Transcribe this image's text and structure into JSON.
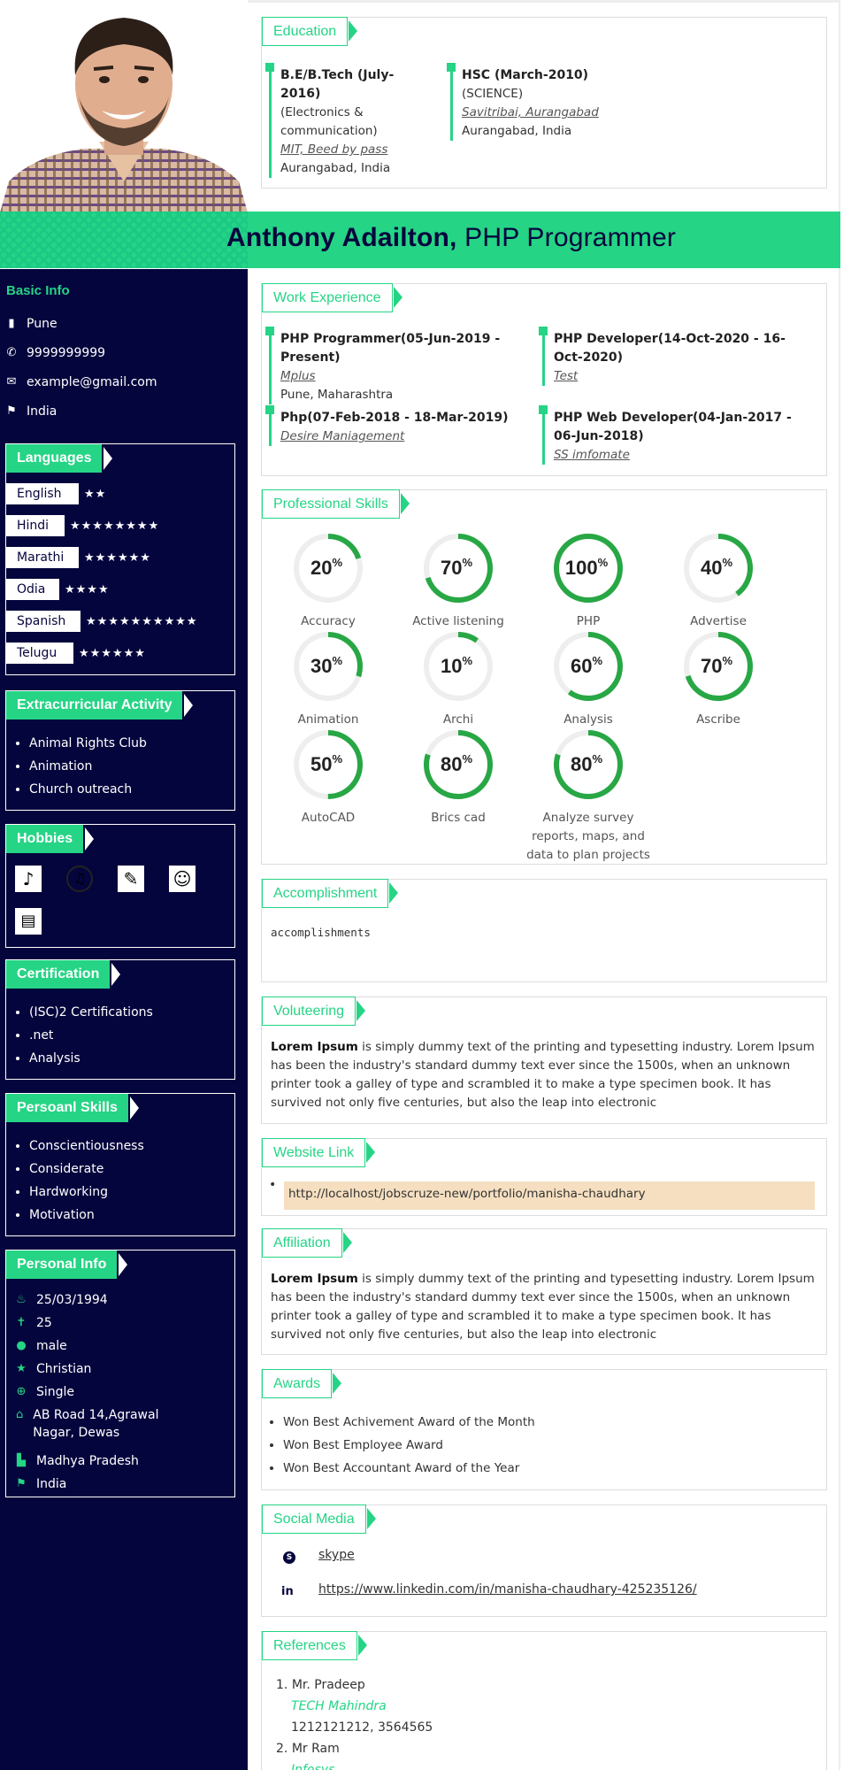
{
  "profile": {
    "first_name": "Anthony Adailton,",
    "role": "PHP Programmer"
  },
  "basic_info": {
    "title": "Basic Info",
    "city": "Pune",
    "phone": "9999999999",
    "email": "example@gmail.com",
    "country": "India"
  },
  "languages": {
    "title": "Languages",
    "items": [
      {
        "name": "English",
        "stars": "★★"
      },
      {
        "name": "Hindi",
        "stars": "★★★★★★★★"
      },
      {
        "name": "Marathi",
        "stars": "★★★★★★"
      },
      {
        "name": "Odia",
        "stars": "★★★★"
      },
      {
        "name": "Spanish",
        "stars": "★★★★★★★★★★"
      },
      {
        "name": "Telugu",
        "stars": "★★★★★★"
      }
    ]
  },
  "extracurricular": {
    "title": "Extracurricular Activity",
    "items": [
      "Animal Rights Club",
      "Animation",
      "Church outreach"
    ]
  },
  "hobbies": {
    "title": "Hobbies",
    "icons": [
      "guitar-icon",
      "music-icon",
      "paint-icon",
      "dance-icon",
      "book-icon"
    ]
  },
  "certification": {
    "title": "Certification",
    "items": [
      "(ISC)2 Certifications",
      ".net",
      "Analysis"
    ]
  },
  "personal_skills": {
    "title": "Persoanl Skills",
    "items": [
      "Conscientiousness",
      "Considerate",
      "Hardworking",
      "Motivation"
    ]
  },
  "personal_info": {
    "title": "Personal Info",
    "dob": "25/03/1994",
    "age": "25",
    "gender": "male",
    "religion": "Christian",
    "status": "Single",
    "address": "AB Road 14,Agrawal Nagar, Dewas",
    "state": "Madhya Pradesh",
    "country": "India"
  },
  "education": {
    "title": "Education",
    "items": [
      {
        "degree": "B.E/B.Tech (July-2016)",
        "field": "(Electronics & communication)",
        "school": "MIT, Beed by pass",
        "place": "Aurangabad, India"
      },
      {
        "degree": "HSC (March-2010)",
        "field": "(SCIENCE)",
        "school": "Savitribai, Aurangabad",
        "place": "Aurangabad, India"
      }
    ]
  },
  "work": {
    "title": "Work Experience",
    "items": [
      {
        "role": "PHP Programmer(05-Jun-2019 - Present)",
        "company": "Mplus",
        "place": "Pune, Maharashtra"
      },
      {
        "role": "PHP Developer(14-Oct-2020 - 16-Oct-2020)",
        "company": "Test",
        "place": ""
      },
      {
        "role": "Php(07-Feb-2018 - 18-Mar-2019)",
        "company": "Desire Maniagement",
        "place": ""
      },
      {
        "role": "PHP Web Developer(04-Jan-2017 - 06-Jun-2018)",
        "company": "SS imfomate",
        "place": ""
      }
    ]
  },
  "skills": {
    "title": "Professional Skills",
    "items": [
      {
        "name": "Accuracy",
        "value": 20
      },
      {
        "name": "Active listening",
        "value": 70
      },
      {
        "name": "PHP",
        "value": 100
      },
      {
        "name": "Advertise",
        "value": 40
      },
      {
        "name": "Animation",
        "value": 30
      },
      {
        "name": "Archi",
        "value": 10
      },
      {
        "name": "Analysis",
        "value": 60
      },
      {
        "name": "Ascribe",
        "value": 70
      },
      {
        "name": "AutoCAD",
        "value": 50
      },
      {
        "name": "Brics cad",
        "value": 80
      },
      {
        "name": "Analyze survey reports, maps, and data to plan projects",
        "value": 80
      }
    ],
    "percent_sign": "%"
  },
  "accomplishment": {
    "title": "Accomplishment",
    "text": "accomplishments"
  },
  "volunteering": {
    "title": "Voluteering",
    "lead": "Lorem Ipsum",
    "text": " is simply dummy text of the printing and typesetting industry. Lorem Ipsum has been the industry's standard dummy text ever since the 1500s, when an unknown printer took a galley of type and scrambled it to make a type specimen book. It has survived not only five centuries, but also the leap into electronic"
  },
  "website": {
    "title": "Website Link",
    "url": "http://localhost/jobscruze-new/portfolio/manisha-chaudhary"
  },
  "affiliation": {
    "title": "Affiliation",
    "lead": "Lorem Ipsum",
    "text": " is simply dummy text of the printing and typesetting industry. Lorem Ipsum has been the industry's standard dummy text ever since the 1500s, when an unknown printer took a galley of type and scrambled it to make a type specimen book. It has survived not only five centuries, but also the leap into electronic"
  },
  "awards": {
    "title": "Awards",
    "items": [
      "Won Best Achivement Award of the Month",
      "Won Best Employee Award",
      "Won Best Accountant Award of the Year"
    ]
  },
  "social": {
    "title": "Social Media",
    "skype": "skype",
    "linkedin": "https://www.linkedin.com/in/manisha-chaudhary-425235126/",
    "skype_glyph": "S",
    "linkedin_glyph": "in"
  },
  "references": {
    "title": "References",
    "items": [
      {
        "n": "1.",
        "name": "Mr. Pradeep",
        "company": "TECH Mahindra",
        "phone": "1212121212, 3564565"
      },
      {
        "n": "2.",
        "name": "Mr Ram",
        "company": "Infosys",
        "phone": ""
      }
    ]
  },
  "colors": {
    "accent": "#25d485",
    "sidebar": "#05053d",
    "ring": "#28a745",
    "ring_bg": "#eeeeee",
    "link_bg": "#f5dfc0"
  }
}
